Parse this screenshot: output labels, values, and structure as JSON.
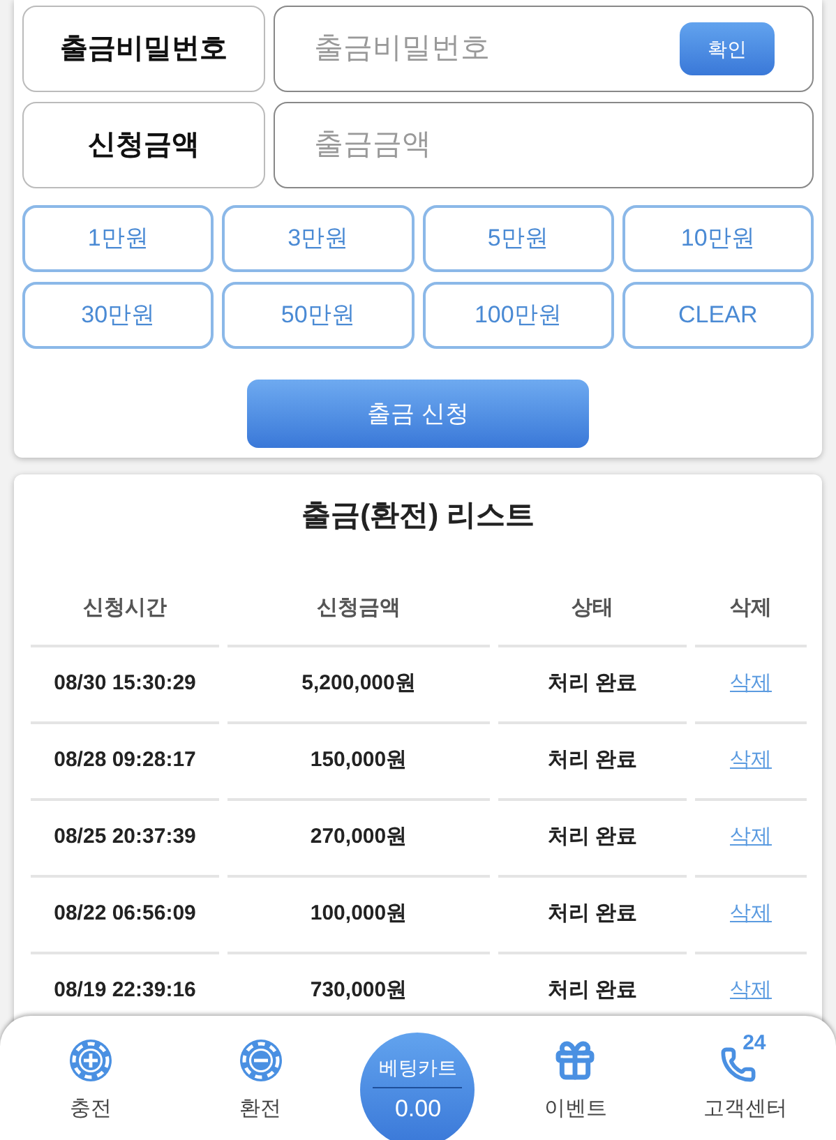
{
  "form": {
    "rows": [
      {
        "label": "출금비밀번호",
        "placeholder": "출금비밀번호",
        "button": "확인"
      },
      {
        "label": "신청금액",
        "placeholder": "출금금액"
      }
    ],
    "amount_buttons": [
      "1만원",
      "3만원",
      "5만원",
      "10만원",
      "30만원",
      "50만원",
      "100만원",
      "CLEAR"
    ],
    "submit_button": "출금 신청"
  },
  "withdraw_list": {
    "title": "출금(환전) 리스트",
    "columns": [
      "신청시간",
      "신청금액",
      "상태",
      "삭제"
    ],
    "rows": [
      {
        "time": "08/30 15:30:29",
        "amount": "5,200,000원",
        "status": "처리 완료",
        "delete": "삭제"
      },
      {
        "time": "08/28 09:28:17",
        "amount": "150,000원",
        "status": "처리 완료",
        "delete": "삭제"
      },
      {
        "time": "08/25 20:37:39",
        "amount": "270,000원",
        "status": "처리 완료",
        "delete": "삭제"
      },
      {
        "time": "08/22 06:56:09",
        "amount": "100,000원",
        "status": "처리 완료",
        "delete": "삭제"
      },
      {
        "time": "08/19 22:39:16",
        "amount": "730,000원",
        "status": "처리 완료",
        "delete": "삭제"
      }
    ]
  },
  "bottom_nav": [
    {
      "kind": "deposit",
      "label": "충전"
    },
    {
      "kind": "withdraw",
      "label": "환전"
    },
    {
      "kind": "cart",
      "label": "베팅카트",
      "value": "0.00"
    },
    {
      "kind": "event",
      "label": "이벤트"
    },
    {
      "kind": "support",
      "label": "고객센터",
      "badge": "24"
    }
  ]
}
